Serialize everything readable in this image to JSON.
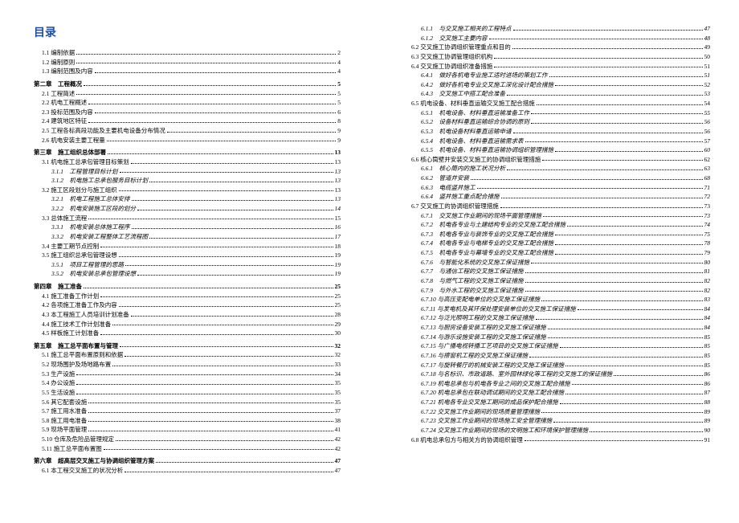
{
  "title": "目录",
  "left": [
    {
      "lvl": 2,
      "label": "1.1  编制依据",
      "pg": "2"
    },
    {
      "lvl": 2,
      "label": "1.2  编制原则",
      "pg": "4"
    },
    {
      "lvl": 2,
      "label": "1.3  编制范围及内容",
      "pg": "4"
    },
    {
      "lvl": 1,
      "chapter": true,
      "label": "第二章　工程概况",
      "pg": "5"
    },
    {
      "lvl": 2,
      "label": "2.1  工程简述",
      "pg": "5"
    },
    {
      "lvl": 2,
      "label": "2.2  机电工程概述",
      "pg": "5"
    },
    {
      "lvl": 2,
      "label": "2.3  投标范围及内容",
      "pg": "6"
    },
    {
      "lvl": 2,
      "label": "2.4  建筑地区特征",
      "pg": "8"
    },
    {
      "lvl": 2,
      "label": "2.5  工程各标高段功能及主要机电设备分布情况",
      "pg": "9"
    },
    {
      "lvl": 2,
      "label": "2.6  机电安装主要工程量",
      "pg": "9"
    },
    {
      "lvl": 1,
      "chapter": true,
      "label": "第三章　施工组织总体部署",
      "pg": "13"
    },
    {
      "lvl": 2,
      "label": "3.1  机电施工总承包管理目标策划",
      "pg": "13"
    },
    {
      "lvl": 3,
      "label": "3.1.1　工程管理目标计划",
      "pg": "13"
    },
    {
      "lvl": 3,
      "label": "3.1.2　机电施工总承包服务目标计划",
      "pg": "13"
    },
    {
      "lvl": 2,
      "label": "3.2  施工区段划分与施工组织",
      "pg": "13"
    },
    {
      "lvl": 3,
      "label": "3.2.1　机电工程施工总体安排",
      "pg": "13"
    },
    {
      "lvl": 3,
      "label": "3.2.2　机电安装施工区段的划分",
      "pg": "14"
    },
    {
      "lvl": 2,
      "label": "3.3  总体施工流程",
      "pg": "15"
    },
    {
      "lvl": 3,
      "label": "3.3.1　机电安装总体施工程序",
      "pg": "16"
    },
    {
      "lvl": 3,
      "label": "3.3.2　机电安装工程整体工艺流程图",
      "pg": "17"
    },
    {
      "lvl": 2,
      "label": "3.4  主要工期节点控制",
      "pg": "18"
    },
    {
      "lvl": 2,
      "label": "3.5  施工组织总承包管理设想",
      "pg": "19"
    },
    {
      "lvl": 3,
      "label": "3.5.1　项目工程管理的思路",
      "pg": "19"
    },
    {
      "lvl": 3,
      "label": "3.5.2　机电安装总承包管理设想",
      "pg": "19"
    },
    {
      "lvl": 1,
      "chapter": true,
      "label": "第四章　施工准备",
      "pg": "25"
    },
    {
      "lvl": 2,
      "label": "4.1  施工准备工作计划",
      "pg": "25"
    },
    {
      "lvl": 2,
      "label": "4.2  各项施工准备工作及内容",
      "pg": "25"
    },
    {
      "lvl": 2,
      "label": "4.3  本工程施工人员培训计划准备",
      "pg": "28"
    },
    {
      "lvl": 2,
      "label": "4.4  施工技术工作计划准备",
      "pg": "29"
    },
    {
      "lvl": 2,
      "label": "4.5  样板施工计划准备",
      "pg": "30"
    },
    {
      "lvl": 1,
      "chapter": true,
      "label": "第五章　施工总平面布置与管理",
      "pg": "32"
    },
    {
      "lvl": 2,
      "label": "5.1  施工总平面布置原则和依据",
      "pg": "32"
    },
    {
      "lvl": 2,
      "label": "5.2  现场围护及场地路布置",
      "pg": "33"
    },
    {
      "lvl": 2,
      "label": "5.3  生产设施",
      "pg": "34"
    },
    {
      "lvl": 2,
      "label": "5.4  办公设施",
      "pg": "35"
    },
    {
      "lvl": 2,
      "label": "5.5  生活设施",
      "pg": "35"
    },
    {
      "lvl": 2,
      "label": "5.6  其它配套设施",
      "pg": "35"
    },
    {
      "lvl": 2,
      "label": "5.7  施工用水准备",
      "pg": "37"
    },
    {
      "lvl": 2,
      "label": "5.8  施工用电准备",
      "pg": "38"
    },
    {
      "lvl": 2,
      "label": "5.9  现场平面管理",
      "pg": "41"
    },
    {
      "lvl": 2,
      "label": "5.10  仓库及危险品管理规定",
      "pg": "42"
    },
    {
      "lvl": 2,
      "label": "5.11  施工总平面布置图",
      "pg": "42"
    },
    {
      "lvl": 1,
      "chapter": true,
      "label": "第六章　超高层交叉施工与协调组织管理方案",
      "pg": "47"
    },
    {
      "lvl": 2,
      "label": "6.1  本工程交叉施工的状况分析",
      "pg": "47"
    }
  ],
  "right": [
    {
      "lvl": 3,
      "label": "6.1.1　与交叉施工相关的工程特点",
      "pg": "47"
    },
    {
      "lvl": 3,
      "label": "6.1.2　交叉施工主要内容",
      "pg": "48"
    },
    {
      "lvl": 2,
      "label": "6.2  交叉施工协调组织管理重点和目的",
      "pg": "49"
    },
    {
      "lvl": 2,
      "label": "6.3  交叉施工协调管理组织机构",
      "pg": "50"
    },
    {
      "lvl": 2,
      "label": "6.4  交叉施工协调组织准备措施",
      "pg": "51"
    },
    {
      "lvl": 3,
      "label": "6.4.1　做好各机电专业施工适时进场的策划工作",
      "pg": "51"
    },
    {
      "lvl": 3,
      "label": "6.4.2　做好各机电专业交叉施工深化设计配合措施",
      "pg": "52"
    },
    {
      "lvl": 3,
      "label": "6.4.3　交叉施工中搭工配合准备",
      "pg": "53"
    },
    {
      "lvl": 2,
      "label": "6.5  机电设备、材料垂直运输交叉施工配合措施",
      "pg": "54"
    },
    {
      "lvl": 3,
      "label": "6.5.1　机电设备、材料垂直运输准备工作",
      "pg": "55"
    },
    {
      "lvl": 3,
      "label": "6.5.2　设备材料垂直运输综合协调的原则",
      "pg": "56"
    },
    {
      "lvl": 3,
      "label": "6.5.3　机电设备材料垂直运输申请",
      "pg": "56"
    },
    {
      "lvl": 3,
      "label": "6.5.4　机电设备、材料垂直运输需求表",
      "pg": "57"
    },
    {
      "lvl": 3,
      "label": "6.5.5　机电设备、材料垂直运输协调组织管理措施",
      "pg": "60"
    },
    {
      "lvl": 2,
      "label": "6.6  核心筒壁并安装交叉施工的协调组织管理措施",
      "pg": "62"
    },
    {
      "lvl": 3,
      "label": "6.6.1　核心筒内的施工状况分析",
      "pg": "63"
    },
    {
      "lvl": 3,
      "label": "6.6.2　管道井安装",
      "pg": "68"
    },
    {
      "lvl": 3,
      "label": "6.6.3　电缆竖井施工",
      "pg": "71"
    },
    {
      "lvl": 3,
      "label": "6.6.4　竖井施工重点配合措施",
      "pg": "72"
    },
    {
      "lvl": 2,
      "label": "6.7  交叉施工的协调组织管理措施",
      "pg": "73"
    },
    {
      "lvl": 3,
      "label": "6.7.1　交叉施工作业期间的现场平面管理措施",
      "pg": "73"
    },
    {
      "lvl": 3,
      "label": "6.7.2　机电各专业与土建结构专业的交叉施工配合措施",
      "pg": "74"
    },
    {
      "lvl": 3,
      "label": "6.7.3　机电各专业与装饰专业的交叉施工配合措施",
      "pg": "75"
    },
    {
      "lvl": 3,
      "label": "6.7.4　机电各专业与电梯专业的交叉施工配合措施",
      "pg": "78"
    },
    {
      "lvl": 3,
      "label": "6.7.5　机电各专业与幕墙专业的交叉施工配合措施",
      "pg": "79"
    },
    {
      "lvl": 3,
      "label": "6.7.6　与智能化系统的交叉施工保证措施",
      "pg": "80"
    },
    {
      "lvl": 3,
      "label": "6.7.7　与通信工程的交叉施工保证措施",
      "pg": "81"
    },
    {
      "lvl": 3,
      "label": "6.7.8　与燃气工程的交叉施工保证措施",
      "pg": "82"
    },
    {
      "lvl": 3,
      "label": "6.7.9　与外水工程的交叉施工保证措施",
      "pg": "82"
    },
    {
      "lvl": 3,
      "label": "6.7.10  与高压变配电单位的交叉施工保证措施",
      "pg": "83"
    },
    {
      "lvl": 3,
      "label": "6.7.11  与发电机及其环保处理安装单位的交叉施工保证措施",
      "pg": "84"
    },
    {
      "lvl": 3,
      "label": "6.7.12  与泛光照明工程的交叉施工保证措施",
      "pg": "84"
    },
    {
      "lvl": 3,
      "label": "6.7.13  与厨房设备安装工程的交叉施工保证措施",
      "pg": "84"
    },
    {
      "lvl": 3,
      "label": "6.7.14  与游乐设施安装工程的交叉施工保证措施",
      "pg": "85"
    },
    {
      "lvl": 3,
      "label": "6.7.15  与广播电视转播工艺项目的交叉施工保证措施",
      "pg": "85"
    },
    {
      "lvl": 3,
      "label": "6.7.16  与擦窗机工程的交叉施工保证措施",
      "pg": "85"
    },
    {
      "lvl": 3,
      "label": "6.7.17  与旋转餐厅的机械安装工程的交叉施工保证措施",
      "pg": "85"
    },
    {
      "lvl": 3,
      "label": "6.7.18  与名标识、市政道路、室外园林绿化等工程的交叉施工的保证措施",
      "pg": "86"
    },
    {
      "lvl": 3,
      "label": "6.7.19  机电总承包与机电各专业之间的交叉施工配合措施",
      "pg": "86"
    },
    {
      "lvl": 3,
      "label": "6.7.20  机电总承包在联动调试期间的交叉施工配合措施",
      "pg": "87"
    },
    {
      "lvl": 3,
      "label": "6.7.21  机电各专业交叉施工期间的成品保护配合措施",
      "pg": "88"
    },
    {
      "lvl": 3,
      "label": "6.7.22  交叉施工作业期间的现场质量管理措施",
      "pg": "89"
    },
    {
      "lvl": 3,
      "label": "6.7.23  交叉施工作业期间的现场施工安全管理措施",
      "pg": "89"
    },
    {
      "lvl": 3,
      "label": "6.7.24  交叉施工作业期间的现场的文明施工和环境保护管理措施",
      "pg": "90"
    },
    {
      "lvl": 2,
      "label": "6.8  机电总承包方与相关方的协调组织管理",
      "pg": "91"
    }
  ]
}
